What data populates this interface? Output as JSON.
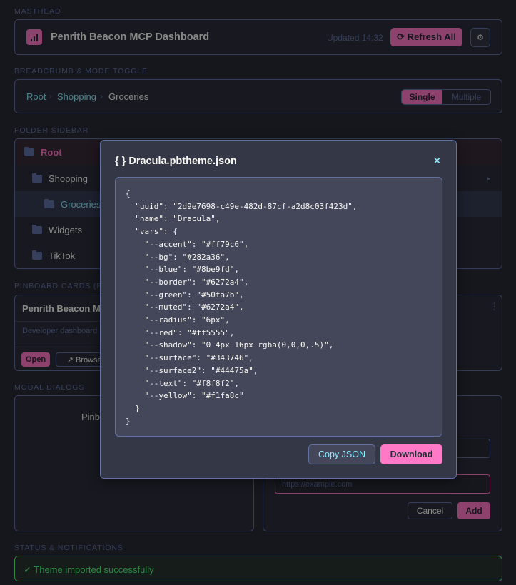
{
  "sections": {
    "masthead": "Masthead",
    "breadcrumb": "Breadcrumb & Mode Toggle",
    "sidebar": "Folder Sidebar",
    "pinboard": "Pinboard Cards (Fl",
    "modals": "Modal Dialogs",
    "status": "Status & Notifications"
  },
  "masthead": {
    "title": "Penrith Beacon MCP Dashboard",
    "updated": "Updated 14:32",
    "refresh_label": "⟳ Refresh All",
    "settings_icon": "gear-icon"
  },
  "breadcrumb": {
    "items": [
      "Root",
      "Shopping",
      "Groceries"
    ],
    "separator": "›",
    "mode_options": [
      "Single",
      "Multiple"
    ],
    "mode_selected": "Single"
  },
  "sidebar": {
    "items": [
      {
        "label": "Root"
      },
      {
        "label": "Shopping"
      },
      {
        "label": "Groceries"
      },
      {
        "label": "Widgets"
      },
      {
        "label": "TikTok"
      }
    ],
    "expand_icon": "▸"
  },
  "pinboard": {
    "card_title": "Penrith Beacon MC",
    "card_desc": "Developer dashboard",
    "open_label": "Open",
    "browser_label": "↗ Browser",
    "menu_icon": "⋮"
  },
  "modal_area": {
    "left_text": "Pinb",
    "url_placeholder": "https://example.com",
    "cancel_label": "Cancel",
    "add_label": "Add"
  },
  "status": {
    "message": "✓ Theme imported successfully"
  },
  "theme_modal": {
    "title": "{ } Dracula.pbtheme.json",
    "close_label": "×",
    "json_text": "{\n  \"uuid\": \"2d9e7698-c49e-482d-87cf-a2d8c03f423d\",\n  \"name\": \"Dracula\",\n  \"vars\": {\n    \"--accent\": \"#ff79c6\",\n    \"--bg\": \"#282a36\",\n    \"--blue\": \"#8be9fd\",\n    \"--border\": \"#6272a4\",\n    \"--green\": \"#50fa7b\",\n    \"--muted\": \"#6272a4\",\n    \"--radius\": \"6px\",\n    \"--red\": \"#ff5555\",\n    \"--shadow\": \"0 4px 16px rgba(0,0,0,.5)\",\n    \"--surface\": \"#343746\",\n    \"--surface2\": \"#44475a\",\n    \"--text\": \"#f8f8f2\",\n    \"--yellow\": \"#f1fa8c\"\n  }\n}",
    "copy_label": "Copy JSON",
    "download_label": "Download"
  },
  "colors": {
    "accent": "#ff79c6",
    "bg": "#282a36",
    "blue": "#8be9fd",
    "border": "#6272a4",
    "green": "#50fa7b",
    "surface": "#343746",
    "surface2": "#44475a",
    "text": "#f8f8f2"
  }
}
